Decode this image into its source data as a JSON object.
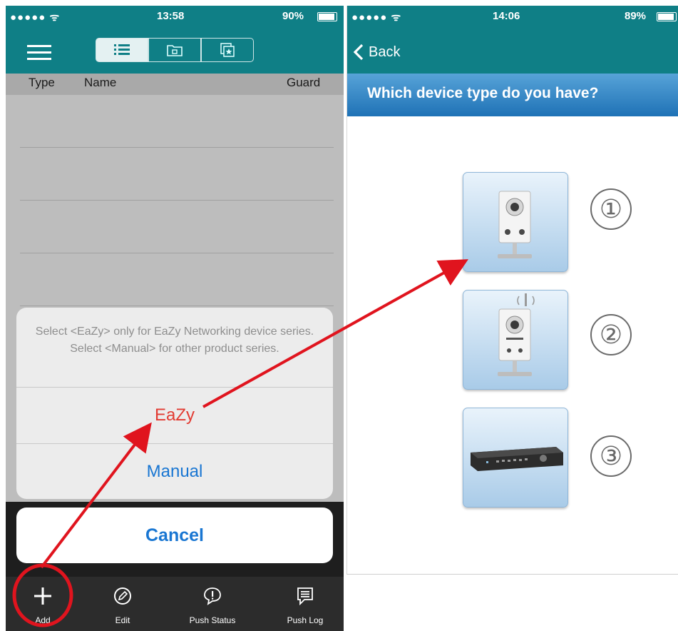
{
  "left_phone": {
    "status": {
      "signal": "●●●●● ᯤ",
      "time": "13:58",
      "battery": "90%"
    },
    "columns": {
      "type": "Type",
      "name": "Name",
      "guard": "Guard"
    },
    "action_sheet": {
      "message": "Select <EaZy> only for EaZy Networking device series. Select <Manual> for other product series.",
      "eazy": "EaZy",
      "manual": "Manual",
      "cancel": "Cancel"
    },
    "tabs": [
      {
        "label": "Add",
        "icon": "plus-icon"
      },
      {
        "label": "Edit",
        "icon": "pencil-icon"
      },
      {
        "label": "Push Status",
        "icon": "alert-bubble-icon"
      },
      {
        "label": "Push Log",
        "icon": "log-bubble-icon"
      }
    ],
    "segments": [
      "list-icon",
      "folder-icon",
      "favorite-icon"
    ]
  },
  "right_phone": {
    "status": {
      "signal": "●●●●● ᯤ",
      "time": "14:06",
      "battery": "89%"
    },
    "back": "Back",
    "question": "Which device type do you have?",
    "devices": [
      {
        "number": "①",
        "icon": "camera-icon"
      },
      {
        "number": "②",
        "icon": "wireless-camera-icon"
      },
      {
        "number": "③",
        "icon": "dvr-recorder-icon"
      }
    ]
  },
  "colors": {
    "header": "#0f7f86",
    "eazy_red": "#e23b32",
    "link_blue": "#1976d2",
    "annotation_red": "#e0141e"
  }
}
